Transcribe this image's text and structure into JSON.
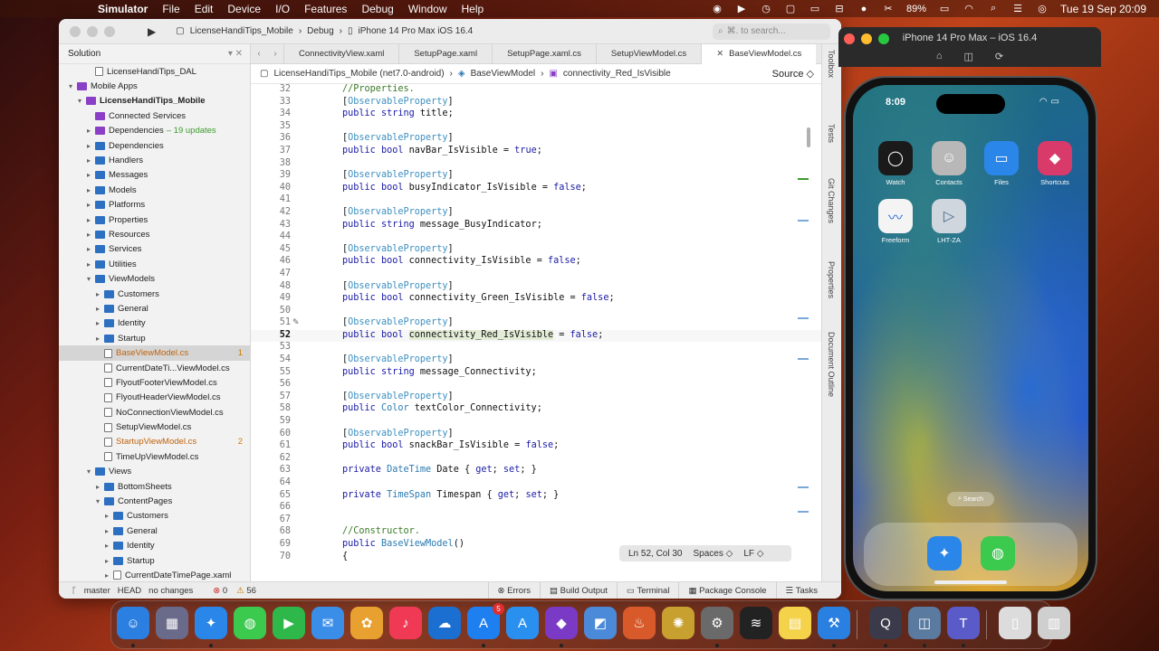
{
  "menubar": {
    "items": [
      "Simulator",
      "File",
      "Edit",
      "Device",
      "I/O",
      "Features",
      "Debug",
      "Window",
      "Help"
    ],
    "battery": "89%",
    "datetime": "Tue 19 Sep  20:09"
  },
  "ide": {
    "breadcrumb": [
      "LicenseHandiTips_Mobile",
      "Debug",
      "iPhone 14 Pro Max iOS 16.4"
    ],
    "search_placeholder": "⌘. to search...",
    "sidebar_title": "Solution",
    "tree": [
      {
        "label": "LicenseHandiTips_DAL",
        "indent": 2,
        "icon": "file",
        "chev": ""
      },
      {
        "label": "Mobile Apps",
        "indent": 0,
        "icon": "purple",
        "chev": "▾"
      },
      {
        "label": "LicenseHandiTips_Mobile",
        "indent": 1,
        "icon": "purple",
        "chev": "▾",
        "bold": true
      },
      {
        "label": "Connected Services",
        "indent": 2,
        "icon": "purple",
        "chev": ""
      },
      {
        "label": "Dependencies",
        "indent": 2,
        "icon": "purple",
        "chev": "▸",
        "extra": "– 19 updates"
      },
      {
        "label": "Dependencies",
        "indent": 2,
        "icon": "folder",
        "chev": "▸"
      },
      {
        "label": "Handlers",
        "indent": 2,
        "icon": "folder",
        "chev": "▸"
      },
      {
        "label": "Messages",
        "indent": 2,
        "icon": "folder",
        "chev": "▸"
      },
      {
        "label": "Models",
        "indent": 2,
        "icon": "folder",
        "chev": "▸"
      },
      {
        "label": "Platforms",
        "indent": 2,
        "icon": "folder",
        "chev": "▸"
      },
      {
        "label": "Properties",
        "indent": 2,
        "icon": "folder",
        "chev": "▸"
      },
      {
        "label": "Resources",
        "indent": 2,
        "icon": "folder",
        "chev": "▸"
      },
      {
        "label": "Services",
        "indent": 2,
        "icon": "folder",
        "chev": "▸"
      },
      {
        "label": "Utilities",
        "indent": 2,
        "icon": "folder",
        "chev": "▸"
      },
      {
        "label": "ViewModels",
        "indent": 2,
        "icon": "folder",
        "chev": "▾"
      },
      {
        "label": "Customers",
        "indent": 3,
        "icon": "folder",
        "chev": "▸"
      },
      {
        "label": "General",
        "indent": 3,
        "icon": "folder",
        "chev": "▸"
      },
      {
        "label": "Identity",
        "indent": 3,
        "icon": "folder",
        "chev": "▸"
      },
      {
        "label": "Startup",
        "indent": 3,
        "icon": "folder",
        "chev": "▸"
      },
      {
        "label": "BaseViewModel.cs",
        "indent": 3,
        "icon": "file",
        "chev": "",
        "badge": "1",
        "modified": true,
        "selected": true
      },
      {
        "label": "CurrentDateTi...ViewModel.cs",
        "indent": 3,
        "icon": "file",
        "chev": ""
      },
      {
        "label": "FlyoutFooterViewModel.cs",
        "indent": 3,
        "icon": "file",
        "chev": ""
      },
      {
        "label": "FlyoutHeaderViewModel.cs",
        "indent": 3,
        "icon": "file",
        "chev": ""
      },
      {
        "label": "NoConnectionViewModel.cs",
        "indent": 3,
        "icon": "file",
        "chev": ""
      },
      {
        "label": "SetupViewModel.cs",
        "indent": 3,
        "icon": "file",
        "chev": ""
      },
      {
        "label": "StartupViewModel.cs",
        "indent": 3,
        "icon": "file",
        "chev": "",
        "badge": "2",
        "modified": true
      },
      {
        "label": "TimeUpViewModel.cs",
        "indent": 3,
        "icon": "file",
        "chev": ""
      },
      {
        "label": "Views",
        "indent": 2,
        "icon": "folder",
        "chev": "▾"
      },
      {
        "label": "BottomSheets",
        "indent": 3,
        "icon": "folder",
        "chev": "▸"
      },
      {
        "label": "ContentPages",
        "indent": 3,
        "icon": "folder",
        "chev": "▾"
      },
      {
        "label": "Customers",
        "indent": 4,
        "icon": "folder",
        "chev": "▸"
      },
      {
        "label": "General",
        "indent": 4,
        "icon": "folder",
        "chev": "▸"
      },
      {
        "label": "Identity",
        "indent": 4,
        "icon": "folder",
        "chev": "▸"
      },
      {
        "label": "Startup",
        "indent": 4,
        "icon": "folder",
        "chev": "▸"
      },
      {
        "label": "CurrentDateTimePage.xaml",
        "indent": 4,
        "icon": "file",
        "chev": "▸"
      }
    ],
    "tabs": [
      "ConnectivityView.xaml",
      "SetupPage.xaml",
      "SetupPage.xaml.cs",
      "SetupViewModel.cs",
      "BaseViewModel.cs"
    ],
    "active_tab": "BaseViewModel.cs",
    "path": [
      "LicenseHandiTips_Mobile (net7.0-android)",
      "BaseViewModel",
      "connectivity_Red_IsVisible"
    ],
    "source_label": "Source ◇",
    "code_lines": [
      {
        "n": "32",
        "c": "//Properties."
      },
      {
        "n": "33",
        "c": "[ObservableProperty]"
      },
      {
        "n": "34",
        "c": "public string title;"
      },
      {
        "n": "35",
        "c": ""
      },
      {
        "n": "36",
        "c": "[ObservableProperty]"
      },
      {
        "n": "37",
        "c": "public bool navBar_IsVisible = true;"
      },
      {
        "n": "38",
        "c": ""
      },
      {
        "n": "39",
        "c": "[ObservableProperty]"
      },
      {
        "n": "40",
        "c": "public bool busyIndicator_IsVisible = false;"
      },
      {
        "n": "41",
        "c": ""
      },
      {
        "n": "42",
        "c": "[ObservableProperty]"
      },
      {
        "n": "43",
        "c": "public string message_BusyIndicator;"
      },
      {
        "n": "44",
        "c": ""
      },
      {
        "n": "45",
        "c": "[ObservableProperty]"
      },
      {
        "n": "46",
        "c": "public bool connectivity_IsVisible = false;"
      },
      {
        "n": "47",
        "c": ""
      },
      {
        "n": "48",
        "c": "[ObservableProperty]"
      },
      {
        "n": "49",
        "c": "public bool connectivity_Green_IsVisible = false;"
      },
      {
        "n": "50",
        "c": ""
      },
      {
        "n": "51",
        "c": "[ObservableProperty]"
      },
      {
        "n": "52",
        "c": "public bool connectivity_Red_IsVisible = false;"
      },
      {
        "n": "53",
        "c": ""
      },
      {
        "n": "54",
        "c": "[ObservableProperty]"
      },
      {
        "n": "55",
        "c": "public string message_Connectivity;"
      },
      {
        "n": "56",
        "c": ""
      },
      {
        "n": "57",
        "c": "[ObservableProperty]"
      },
      {
        "n": "58",
        "c": "public Color textColor_Connectivity;"
      },
      {
        "n": "59",
        "c": ""
      },
      {
        "n": "60",
        "c": "[ObservableProperty]"
      },
      {
        "n": "61",
        "c": "public bool snackBar_IsVisible = false;"
      },
      {
        "n": "62",
        "c": ""
      },
      {
        "n": "63",
        "c": "private DateTime Date { get; set; }"
      },
      {
        "n": "64",
        "c": ""
      },
      {
        "n": "65",
        "c": "private TimeSpan Timespan { get; set; }"
      },
      {
        "n": "66",
        "c": ""
      },
      {
        "n": "67",
        "c": ""
      },
      {
        "n": "68",
        "c": "//Constructor."
      },
      {
        "n": "69",
        "c": "public BaseViewModel()"
      },
      {
        "n": "70",
        "c": "{"
      }
    ],
    "current_line": "52",
    "cursor_status": {
      "position": "Ln 52, Col 30",
      "indent": "Spaces",
      "eol": "LF"
    },
    "right_dock": [
      "Toolbox",
      "Tests",
      "Git Changes",
      "Properties",
      "Document Outline"
    ],
    "bottom": {
      "branch": "master",
      "head": "HEAD",
      "changes": "no changes",
      "errors": "0",
      "warnings": "56",
      "panels": [
        "Errors",
        "Build Output",
        "Terminal",
        "Package Console",
        "Tasks"
      ]
    }
  },
  "simulator": {
    "title": "iPhone 14 Pro Max – iOS 16.4",
    "time": "8:09",
    "apps": [
      {
        "label": "Watch",
        "color": "#1a1a1a"
      },
      {
        "label": "Contacts",
        "color": "#b8b8b8"
      },
      {
        "label": "Files",
        "color": "#2a86e8"
      },
      {
        "label": "Shortcuts",
        "color": "#d83a6a"
      },
      {
        "label": "Freeform",
        "color": "#f4f4f4"
      },
      {
        "label": "LHT-ZA",
        "color": "#cfd6de"
      }
    ],
    "search_label": "Search",
    "dock_apps": [
      {
        "name": "safari",
        "color": "#2a86e8"
      },
      {
        "name": "messages",
        "color": "#3bc94e"
      }
    ]
  },
  "macdock": {
    "apps": [
      {
        "name": "finder",
        "color": "#2b7fe0"
      },
      {
        "name": "launchpad",
        "color": "#6a6a8a"
      },
      {
        "name": "safari",
        "color": "#2a86e8"
      },
      {
        "name": "messages",
        "color": "#3bc94e"
      },
      {
        "name": "facetime",
        "color": "#2fb84a"
      },
      {
        "name": "mail",
        "color": "#3a8ee8"
      },
      {
        "name": "photos",
        "color": "#e8a030"
      },
      {
        "name": "music",
        "color": "#f03a55"
      },
      {
        "name": "onedrive",
        "color": "#1a6fd0"
      },
      {
        "name": "app-store",
        "color": "#1e80f0",
        "badge": "5"
      },
      {
        "name": "xcode-instruments",
        "color": "#2a90f0"
      },
      {
        "name": "visual-studio",
        "color": "#7a3ac6"
      },
      {
        "name": "activity-tool",
        "color": "#4a8ad8"
      },
      {
        "name": "cocktail",
        "color": "#d85a2a"
      },
      {
        "name": "pineapple",
        "color": "#c8a030"
      },
      {
        "name": "system-settings",
        "color": "#6a6a6a"
      },
      {
        "name": "voice-memos",
        "color": "#222222"
      },
      {
        "name": "notes",
        "color": "#f4d24a"
      },
      {
        "name": "xcode",
        "color": "#2a80e0"
      },
      {
        "name": "quicktime",
        "color": "#3a3a4a"
      },
      {
        "name": "preview",
        "color": "#5a7aa0"
      },
      {
        "name": "teams",
        "color": "#5a5ac8"
      },
      {
        "name": "archive",
        "color": "#dcdcdc"
      },
      {
        "name": "trash",
        "color": "#cfcfcf"
      }
    ]
  }
}
